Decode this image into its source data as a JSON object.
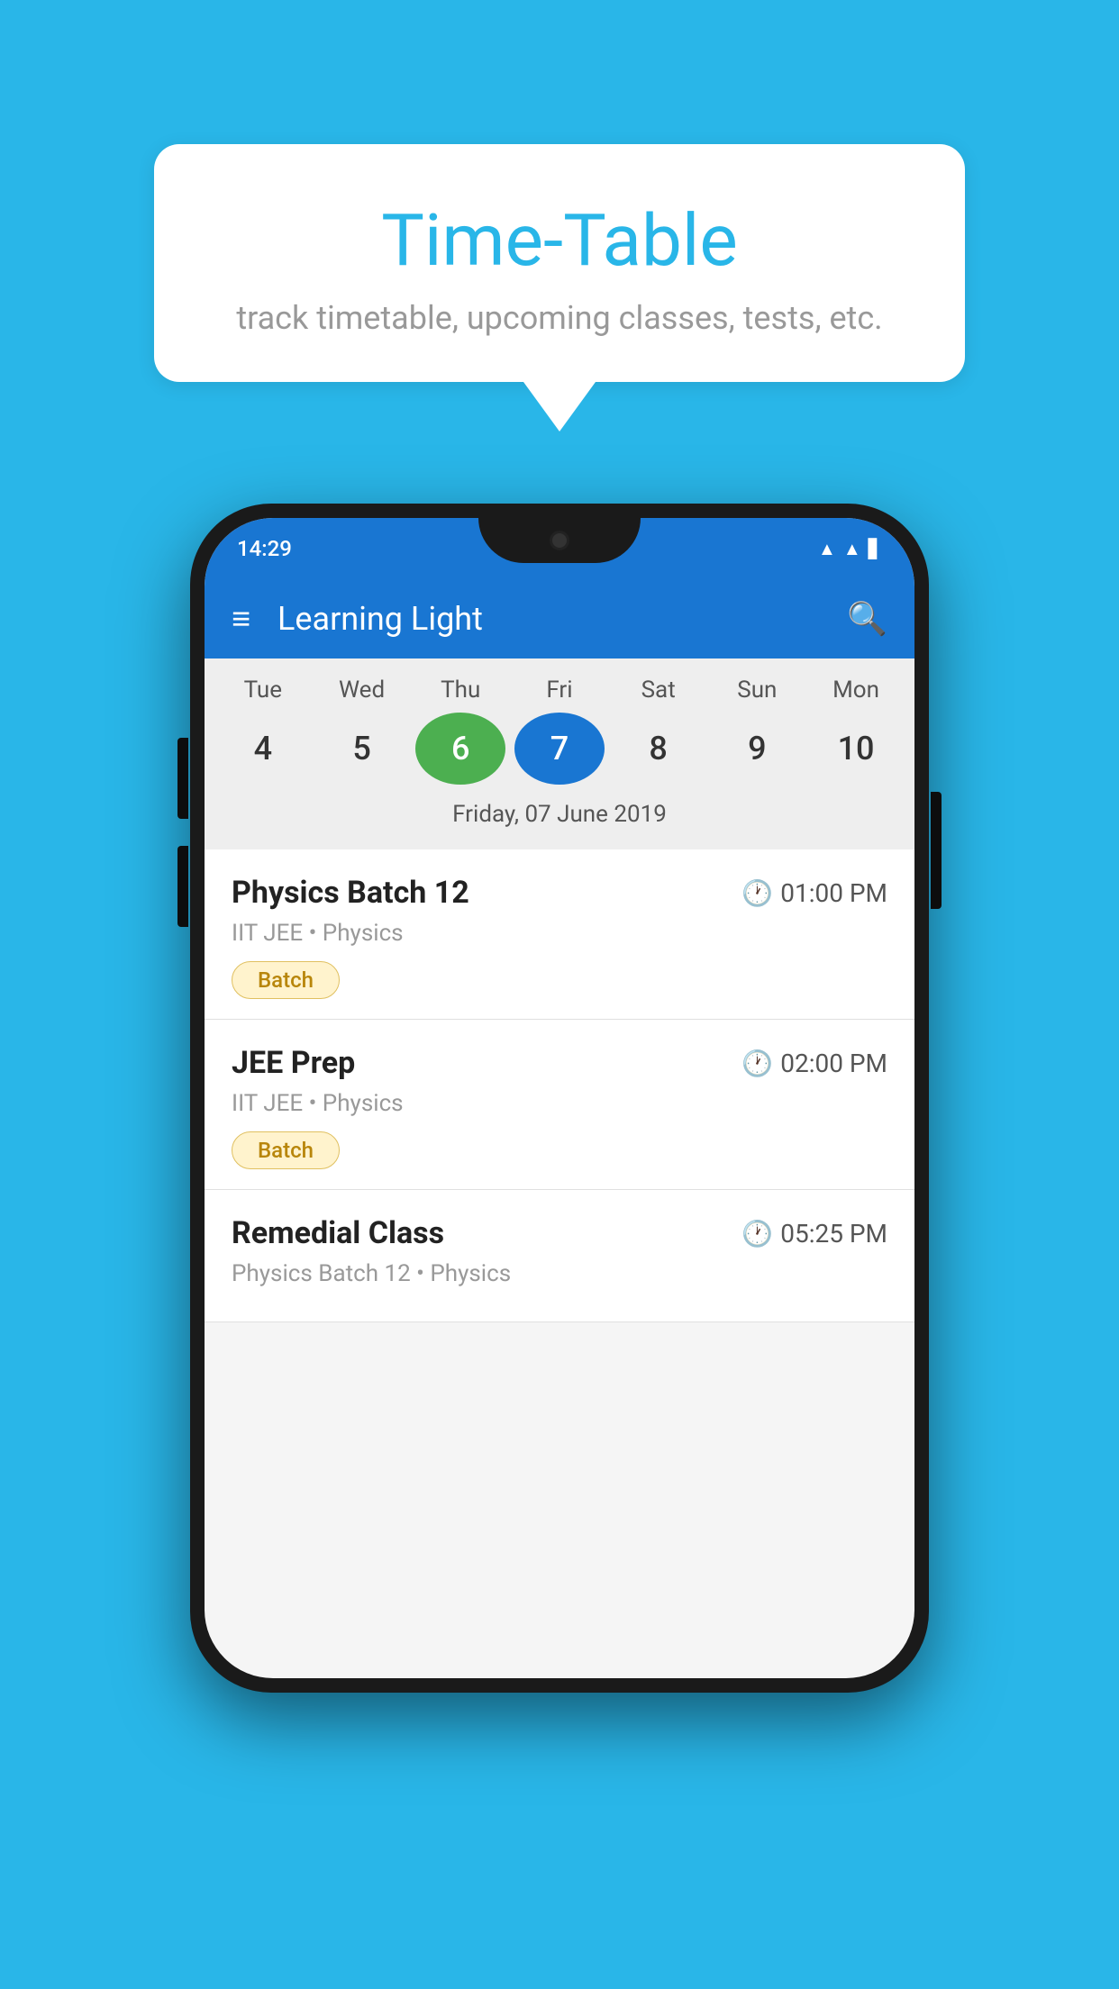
{
  "background_color": "#29b6e8",
  "speech_bubble": {
    "title": "Time-Table",
    "subtitle": "track timetable, upcoming classes, tests, etc."
  },
  "phone": {
    "status_bar": {
      "time": "14:29"
    },
    "app_bar": {
      "title": "Learning Light"
    },
    "calendar": {
      "days": [
        {
          "label": "Tue",
          "num": "4"
        },
        {
          "label": "Wed",
          "num": "5"
        },
        {
          "label": "Thu",
          "num": "6",
          "state": "today"
        },
        {
          "label": "Fri",
          "num": "7",
          "state": "selected"
        },
        {
          "label": "Sat",
          "num": "8"
        },
        {
          "label": "Sun",
          "num": "9"
        },
        {
          "label": "Mon",
          "num": "10"
        }
      ],
      "selected_date_label": "Friday, 07 June 2019"
    },
    "schedule": [
      {
        "title": "Physics Batch 12",
        "time": "01:00 PM",
        "sub": "IIT JEE • Physics",
        "badge": "Batch"
      },
      {
        "title": "JEE Prep",
        "time": "02:00 PM",
        "sub": "IIT JEE • Physics",
        "badge": "Batch"
      },
      {
        "title": "Remedial Class",
        "time": "05:25 PM",
        "sub": "Physics Batch 12 • Physics",
        "badge": ""
      }
    ]
  }
}
